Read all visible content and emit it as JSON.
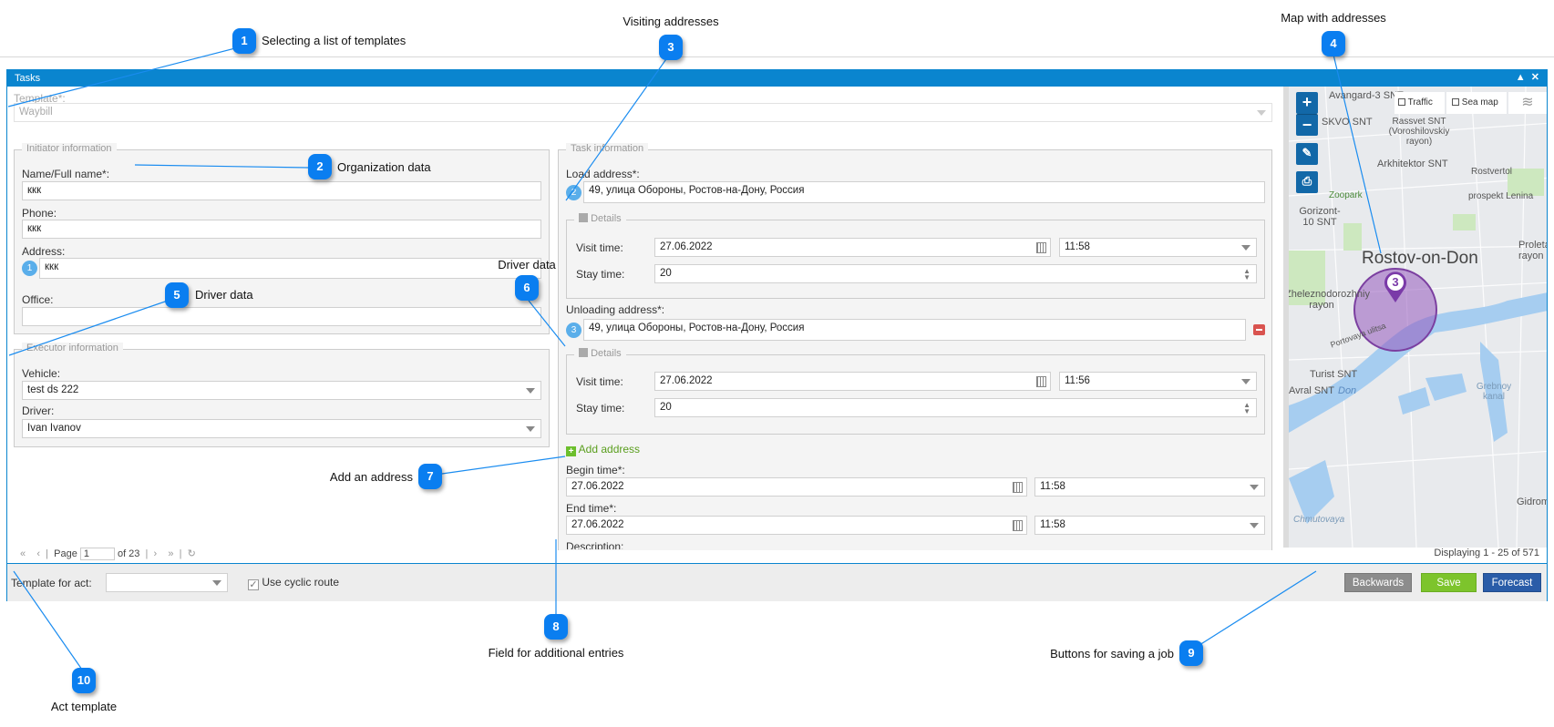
{
  "window": {
    "title": "Tasks",
    "collapse_icon": "triangle-up",
    "close_icon": "x"
  },
  "template": {
    "label": "Template*:",
    "value": "Waybill"
  },
  "initiator": {
    "legend": "Initiator information",
    "name_label": "Name/Full name*:",
    "name_value": "ккк",
    "phone_label": "Phone:",
    "phone_value": "ккк",
    "address_label": "Address:",
    "address_marker": "1",
    "address_value": "ккк",
    "office_label": "Office:",
    "office_value": ""
  },
  "executor": {
    "legend": "Executor information",
    "vehicle_label": "Vehicle:",
    "vehicle_value": "test ds 222",
    "driver_label": "Driver:",
    "driver_value": "Ivan Ivanov"
  },
  "task": {
    "legend": "Task information",
    "load_label": "Load address*:",
    "load_marker": "2",
    "load_value": "49, улица Обороны, Ростов-на-Дону, Россия",
    "details1": {
      "legend": "Details",
      "visit_label": "Visit time:",
      "visit_date": "27.06.2022",
      "visit_time": "11:58",
      "stay_label": "Stay time:",
      "stay_value": "20"
    },
    "unload_label": "Unloading address*:",
    "unload_marker": "3",
    "unload_value": "49, улица Обороны, Ростов-на-Дону, Россия",
    "details2": {
      "legend": "Details",
      "visit_label": "Visit time:",
      "visit_date": "27.06.2022",
      "visit_time": "11:56",
      "stay_label": "Stay time:",
      "stay_value": "20"
    },
    "add_address": "Add address",
    "begin_label": "Begin time*:",
    "begin_date": "27.06.2022",
    "begin_time": "11:58",
    "end_label": "End time*:",
    "end_date": "27.06.2022",
    "end_time": "11:58",
    "description_label": "Description:"
  },
  "map": {
    "traffic": "Traffic",
    "sea_map": "Sea map",
    "cluster_count": "3",
    "city": "Rostov-on-Don",
    "labels": [
      "Avangard-3 SNT",
      "SKVO SNT",
      "Rassvet SNT (Voroshilovskiy rayon)",
      "Arkhitektor SNT",
      "Rostvertol",
      "prospekt Lenina",
      "Zoopark",
      "Gorizont-10 SNT",
      "Proletarskiy rayon",
      "Zheleznodorozhniy rayon",
      "Portovaya ulitsa",
      "Turist SNT",
      "Don",
      "Avral SNT",
      "Grebnoy kanal",
      "Gidromet",
      "Chmutovaya"
    ]
  },
  "pager": {
    "page_label": "Page",
    "page_value": "1",
    "of_label": "of 23",
    "displaying": "Displaying 1 - 25 of 571"
  },
  "footer": {
    "act_label": "Template for act:",
    "act_value": "",
    "cyclic_label": "Use cyclic route",
    "cyclic_checked": true,
    "backwards": "Backwards",
    "save": "Save",
    "forecast": "Forecast"
  },
  "colors": {
    "accent": "#0a85cf",
    "save": "#7dc42c",
    "forecast": "#2a5ca8",
    "backwards": "#8c8c8c",
    "callout": "#0a7ef0",
    "cluster": "#8b4fb0"
  },
  "callouts": [
    {
      "n": "1",
      "text": "Selecting a list of templates"
    },
    {
      "n": "2",
      "text": "Organization data"
    },
    {
      "n": "3",
      "text": "Visiting addresses"
    },
    {
      "n": "4",
      "text": "Map with addresses"
    },
    {
      "n": "5",
      "text": "Driver data"
    },
    {
      "n": "6",
      "text": "Driver data"
    },
    {
      "n": "7",
      "text": "Add an address"
    },
    {
      "n": "8",
      "text": "Field for additional entries"
    },
    {
      "n": "9",
      "text": "Buttons for saving a job"
    },
    {
      "n": "10",
      "text": "Act template"
    }
  ]
}
